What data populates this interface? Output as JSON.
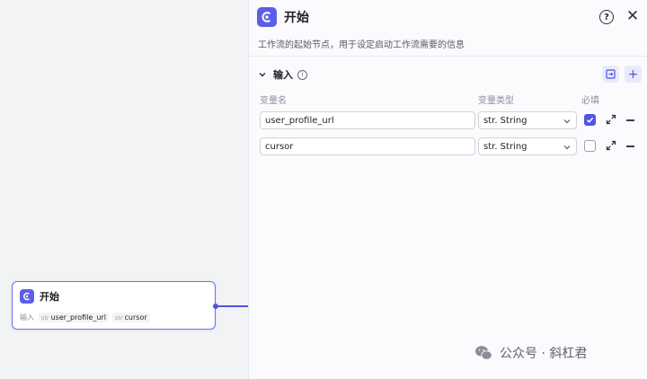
{
  "node": {
    "title": "开始",
    "inputs_label": "输入",
    "chips": [
      {
        "type": "str",
        "name": "user_profile_url"
      },
      {
        "type": "str",
        "name": "cursor"
      }
    ]
  },
  "panel": {
    "title": "开始",
    "help_glyph": "?",
    "close_glyph": "✕",
    "description": "工作流的起始节点，用于设定启动工作流需要的信息",
    "section": {
      "title": "输入",
      "info_glyph": "i",
      "add_glyph": "+"
    },
    "columns": {
      "name": "变量名",
      "type": "变量类型",
      "required": "必填"
    },
    "rows": [
      {
        "name": "user_profile_url",
        "type": "str. String",
        "required": true
      },
      {
        "name": "cursor",
        "type": "str. String",
        "required": false
      }
    ]
  },
  "watermark": {
    "text": "公众号 · 斜杠君"
  },
  "colors": {
    "accent": "#4f55e0",
    "logo_bg": "#5b5fe8"
  }
}
